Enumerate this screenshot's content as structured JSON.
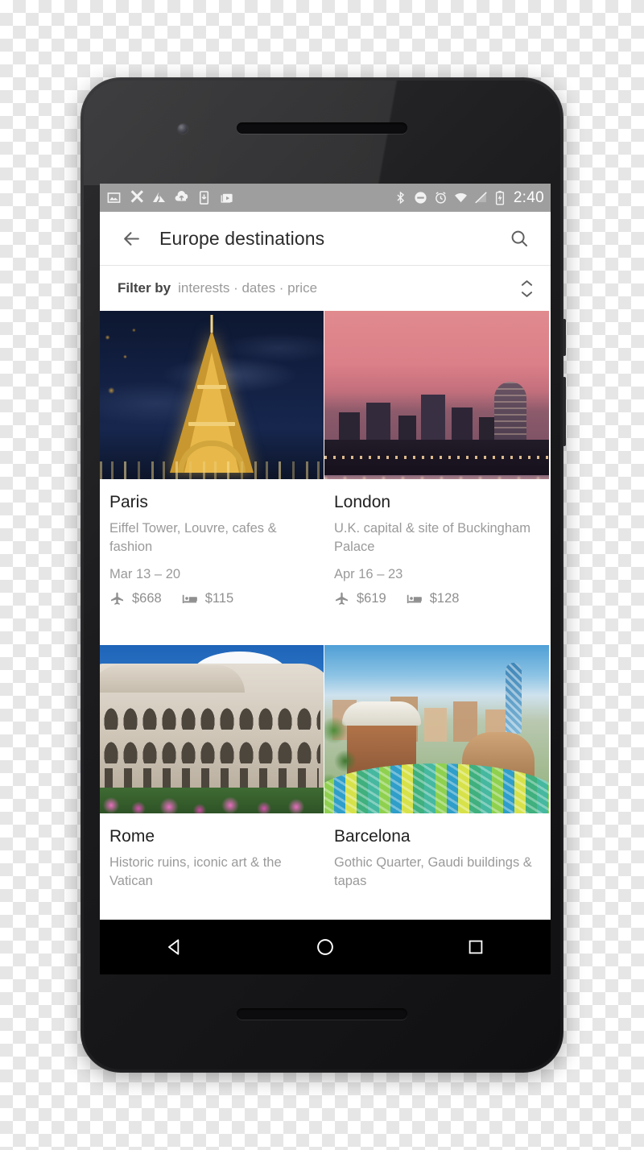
{
  "status_bar": {
    "time": "2:40",
    "left_icons": [
      "photo-icon",
      "crop-tool-icon",
      "drive-icon",
      "cloud-upload-icon",
      "download-to-device-icon",
      "play-store-icon"
    ],
    "right_icons": [
      "bluetooth-icon",
      "do-not-disturb-icon",
      "alarm-icon",
      "wifi-icon",
      "no-signal-icon",
      "battery-charging-icon"
    ]
  },
  "app_bar": {
    "back_icon": "back-arrow-icon",
    "title": "Europe destinations",
    "search_icon": "search-icon"
  },
  "filter_bar": {
    "label": "Filter by",
    "values": "interests · dates · price",
    "expand_icon": "expand-collapse-icon"
  },
  "cards": [
    {
      "name": "Paris",
      "description": "Eiffel Tower, Louvre, cafes & fashion",
      "dates": "Mar 13 – 20",
      "flight_price": "$668",
      "hotel_price": "$115",
      "photo": "eiffel-tower-night"
    },
    {
      "name": "London",
      "description": "U.K. capital & site of Buckingham Palace",
      "dates": "Apr 16 – 23",
      "flight_price": "$619",
      "hotel_price": "$128",
      "photo": "london-skyline-sunset"
    },
    {
      "name": "Rome",
      "description": "Historic ruins, iconic art & the Vatican",
      "dates": "",
      "flight_price": "",
      "hotel_price": "",
      "photo": "colosseum-day"
    },
    {
      "name": "Barcelona",
      "description": "Gothic Quarter, Gaudi buildings & tapas",
      "dates": "",
      "flight_price": "",
      "hotel_price": "",
      "photo": "park-guell-day"
    }
  ],
  "nav_bar": {
    "back_icon": "nav-back-triangle-icon",
    "home_icon": "nav-home-circle-icon",
    "recents_icon": "nav-recents-square-icon"
  },
  "colors": {
    "status_bar_bg": "#9e9e9e",
    "app_bg": "#ffffff",
    "title_text": "#2b2b2b",
    "secondary_text": "#9a9a9a",
    "nav_bar_bg": "#000000"
  }
}
